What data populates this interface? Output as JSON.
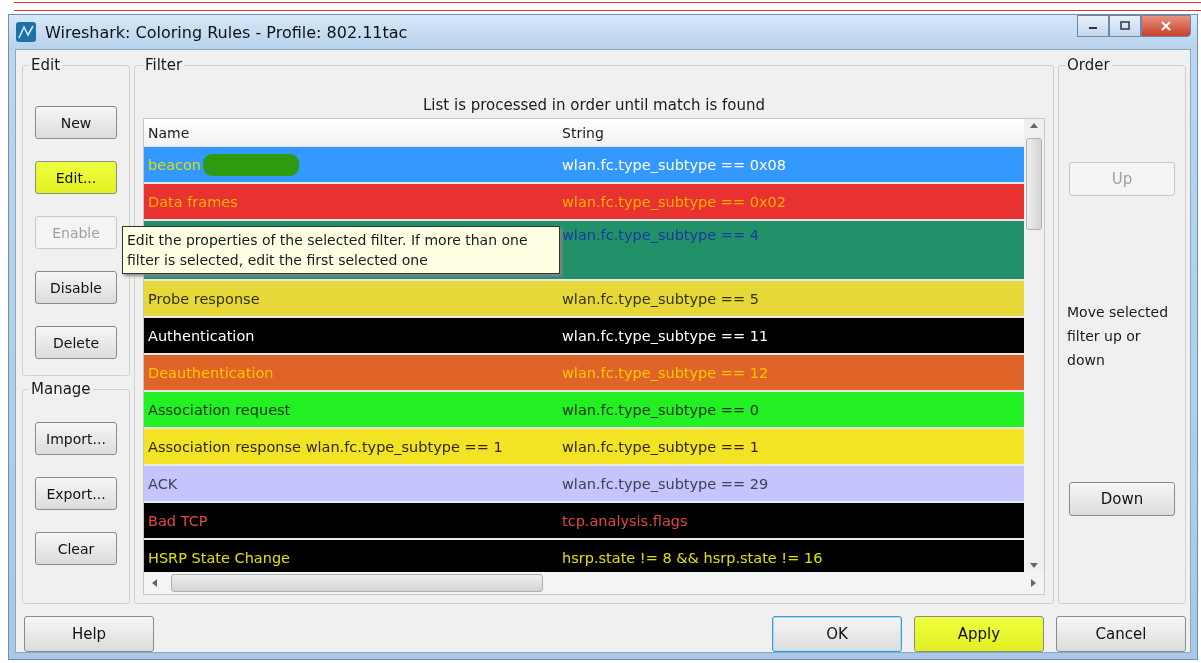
{
  "window": {
    "title": "Wireshark: Coloring Rules - Profile: 802.11tac"
  },
  "edit_group": {
    "label": "Edit",
    "buttons": [
      {
        "label": "New",
        "disabled": false,
        "highlighted": false
      },
      {
        "label": "Edit...",
        "disabled": false,
        "highlighted": true
      },
      {
        "label": "Enable",
        "disabled": true,
        "highlighted": false
      },
      {
        "label": "Disable",
        "disabled": false,
        "highlighted": false
      },
      {
        "label": "Delete",
        "disabled": false,
        "highlighted": false
      }
    ]
  },
  "manage_group": {
    "label": "Manage",
    "buttons": [
      {
        "label": "Import...",
        "disabled": false,
        "highlighted": false
      },
      {
        "label": "Export...",
        "disabled": false,
        "highlighted": false
      },
      {
        "label": "Clear",
        "disabled": false,
        "highlighted": false
      }
    ]
  },
  "filter_group": {
    "label": "Filter",
    "note": "List is processed in order until match is found",
    "table": {
      "columns": [
        "Name",
        "String"
      ],
      "rows": [
        {
          "color": "#3399ff",
          "name": {
            "text": "beacon",
            "color": "#d8e000"
          },
          "string": {
            "text": "wlan.fc.type_subtype == 0x08",
            "color": "#ffffff"
          },
          "redacted": true,
          "tall": false
        },
        {
          "color": "#e83232",
          "name": {
            "text": "Data frames",
            "color": "#ffb000"
          },
          "string": {
            "text": "wlan.fc.type_subtype == 0x02",
            "color": "#ffb000"
          },
          "redacted": false,
          "tall": false
        },
        {
          "color": "#229068",
          "string": {
            "text": "wlan.fc.type_subtype == 4",
            "color": "#1a3aa0"
          },
          "redacted": false,
          "tall": true
        },
        {
          "color": "#e6d838",
          "name": {
            "text": "Probe response",
            "color": "#333300"
          },
          "string": {
            "text": "wlan.fc.type_subtype == 5",
            "color": "#333300"
          },
          "redacted": false,
          "tall": false
        },
        {
          "color": "#000000",
          "name": {
            "text": "Authentication",
            "color": "#ffffff"
          },
          "string": {
            "text": "wlan.fc.type_subtype == 11",
            "color": "#ffffff"
          },
          "redacted": false,
          "tall": false
        },
        {
          "color": "#e06428",
          "name": {
            "text": "Deauthentication",
            "color": "#ffc800"
          },
          "string": {
            "text": "wlan.fc.type_subtype == 12",
            "color": "#ffc800"
          },
          "redacted": false,
          "tall": false
        },
        {
          "color": "#22f022",
          "name": {
            "text": "Association request",
            "color": "#103010"
          },
          "string": {
            "text": "wlan.fc.type_subtype == 0",
            "color": "#103010"
          },
          "redacted": false,
          "tall": false
        },
        {
          "color": "#f2e424",
          "name": {
            "text": "Association response wlan.fc.type_subtype == 1",
            "color": "#302800"
          },
          "string": {
            "text": "wlan.fc.type_subtype == 1",
            "color": "#302800"
          },
          "redacted": false,
          "tall": false
        },
        {
          "color": "#c4c4ff",
          "name": {
            "text": "ACK",
            "color": "#404050"
          },
          "string": {
            "text": "wlan.fc.type_subtype == 29",
            "color": "#404050"
          },
          "redacted": false,
          "tall": false
        },
        {
          "color": "#000000",
          "name": {
            "text": "Bad TCP",
            "color": "#e04848"
          },
          "string": {
            "text": "tcp.analysis.flags",
            "color": "#e04848"
          },
          "redacted": false,
          "tall": false
        },
        {
          "color": "#000000",
          "name": {
            "text": "HSRP State Change",
            "color": "#e0e000"
          },
          "string": {
            "text": "hsrp.state != 8 && hsrp.state != 16",
            "color": "#e0e000"
          },
          "redacted": false,
          "tall": false
        }
      ]
    }
  },
  "tooltip": {
    "text": "Edit the properties of the selected filter. If more than one filter is selected, edit the first selected one"
  },
  "order_group": {
    "label": "Order",
    "buttons": [
      {
        "label": "Up",
        "disabled": true,
        "highlighted": false
      },
      {
        "label": "Down",
        "disabled": false,
        "highlighted": false
      }
    ],
    "hint": "Move selected filter up or down"
  },
  "dialog_buttons": [
    {
      "label": "Help",
      "default": false,
      "highlighted": false
    },
    {
      "label": "OK",
      "default": true,
      "highlighted": false
    },
    {
      "label": "Apply",
      "default": false,
      "highlighted": true
    },
    {
      "label": "Cancel",
      "default": false,
      "highlighted": false
    }
  ]
}
